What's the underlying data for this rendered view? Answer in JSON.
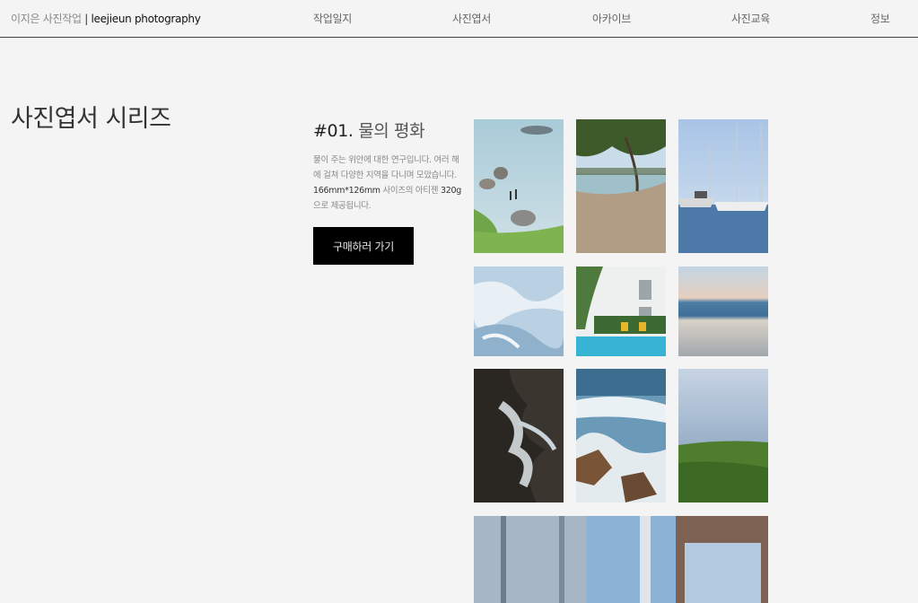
{
  "header": {
    "brand_ko": "이지은 사진작업",
    "brand_sep": " | ",
    "brand_en": "leejieun photography",
    "nav": [
      "작업일지",
      "사진엽서",
      "아카이브",
      "사진교육",
      "정보"
    ]
  },
  "page": {
    "series_title": "사진엽서 시리즈"
  },
  "item": {
    "number": "#01.",
    "name": "물의 평화",
    "desc_part1": "물이 주는 위안에 대한 연구입니다. 여러 해에 걸쳐 다양한 지역을 다니며 모았습니다. ",
    "desc_size": "166mm*126mm",
    "desc_part2": " 사이즈의 아티젠 ",
    "desc_weight": "320g",
    "desc_part3": "으로 제공됩니다.",
    "buy_label": "구매하러 가기"
  },
  "colors": {
    "background": "#f4f4f4",
    "button": "#000000"
  }
}
